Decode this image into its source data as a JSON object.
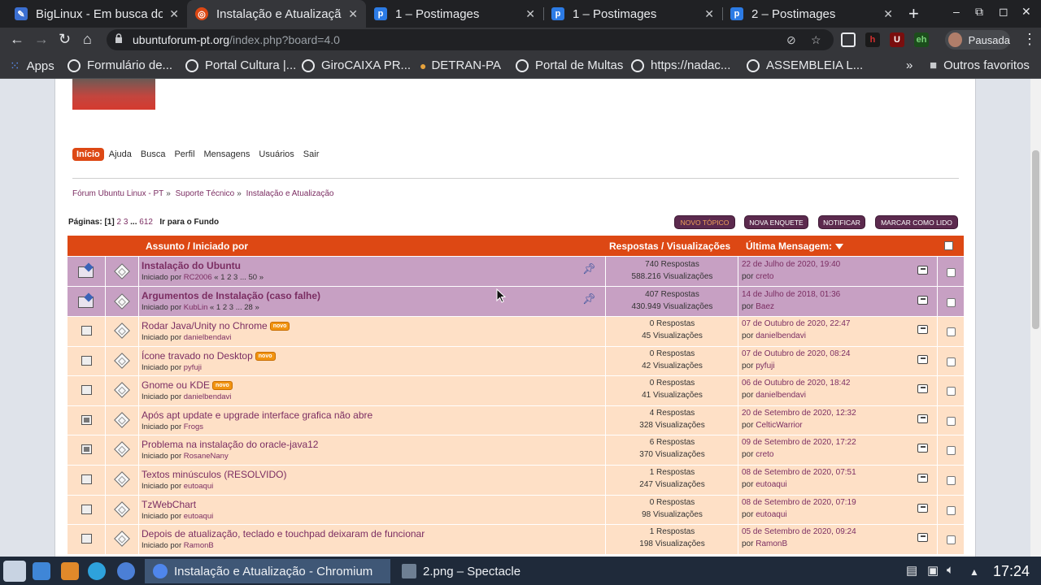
{
  "browser": {
    "tabs": [
      {
        "title": "BigLinux - Em busca do s",
        "fav_color": "#3b6fd1",
        "fav_glyph": "✎"
      },
      {
        "title": "Instalação e Atualização",
        "fav_color": "#dd4814",
        "fav_glyph": "◎",
        "active": true
      },
      {
        "title": "1 – Postimages",
        "fav_color": "#2c7be5",
        "fav_glyph": "p"
      },
      {
        "title": "1 – Postimages",
        "fav_color": "#2c7be5",
        "fav_glyph": "p"
      },
      {
        "title": "2 – Postimages",
        "fav_color": "#2c7be5",
        "fav_glyph": "p"
      }
    ],
    "url_host": "ubuntuforum-pt.org",
    "url_rest": "/index.php?board=4.0",
    "profile_label": "Pausada",
    "bookmarks": [
      "Apps",
      "Formulário de...",
      "Portal Cultura |...",
      "GiroCAIXA PR...",
      "DETRAN-PA",
      "Portal de Multas",
      "https://nadac...",
      "ASSEMBLEIA L...",
      "Outros favoritos"
    ],
    "bookmarks_overflow": "»"
  },
  "forum": {
    "menu": [
      "Início",
      "Ajuda",
      "Busca",
      "Perfil",
      "Mensagens",
      "Usuários",
      "Sair"
    ],
    "breadcrumb": [
      "Fórum Ubuntu Linux - PT",
      "Suporte Técnico",
      "Instalação e Atualização"
    ],
    "pages_label": "Páginas:",
    "pages_current": "1",
    "pages_links": [
      "2",
      "3",
      "...",
      "612"
    ],
    "goto_bottom": "Ir para o Fundo",
    "buttons": [
      "novo tópico",
      "nova enquete",
      "notificar",
      "marcar como lido"
    ],
    "header": {
      "subject": "Assunto / Iniciado por",
      "stats": "Respostas / Visualizações",
      "last": "Última Mensagem:"
    },
    "by_prefix": "Iniciado por",
    "last_prefix": "por",
    "new_badge": "novo",
    "topics": [
      {
        "subject": "Instalação do Ubuntu",
        "author": "RC2006",
        "pages": "« 1 2 3 ... 50 »",
        "replies": "740 Respostas",
        "views": "588.216 Visualizações",
        "last_date": "22 de Julho de 2020, 19:40",
        "last_by": "creto",
        "sticky": true
      },
      {
        "subject": "Argumentos de Instalação (caso falhe)",
        "author": "KubLin",
        "pages": "« 1 2 3 ... 28 »",
        "replies": "407 Respostas",
        "views": "430.949 Visualizações",
        "last_date": "14 de Julho de 2018, 01:36",
        "last_by": "Baez",
        "sticky": true
      },
      {
        "subject": "Rodar Java/Unity no Chrome",
        "author": "danielbendavi",
        "new": true,
        "replies": "0 Respostas",
        "views": "45 Visualizações",
        "last_date": "07 de Outubro de 2020, 22:47",
        "last_by": "danielbendavi"
      },
      {
        "subject": "Ícone travado no Desktop",
        "author": "pyfuji",
        "new": true,
        "replies": "0 Respostas",
        "views": "42 Visualizações",
        "last_date": "07 de Outubro de 2020, 08:24",
        "last_by": "pyfuji"
      },
      {
        "subject": "Gnome ou KDE",
        "author": "danielbendavi",
        "new": true,
        "replies": "0 Respostas",
        "views": "41 Visualizações",
        "last_date": "06 de Outubro de 2020, 18:42",
        "last_by": "danielbendavi"
      },
      {
        "subject": "Após apt update e upgrade interface grafica não abre",
        "author": "Frogs",
        "hot": true,
        "replies": "4 Respostas",
        "views": "328 Visualizações",
        "last_date": "20 de Setembro de 2020, 12:32",
        "last_by": "CelticWarrior"
      },
      {
        "subject": "Problema na instalação do oracle-java12",
        "author": "RosaneNany",
        "hot": true,
        "replies": "6 Respostas",
        "views": "370 Visualizações",
        "last_date": "09 de Setembro de 2020, 17:22",
        "last_by": "creto"
      },
      {
        "subject": "Textos minúsculos (RESOLVIDO)",
        "author": "eutoaqui",
        "replies": "1 Respostas",
        "views": "247 Visualizações",
        "last_date": "08 de Setembro de 2020, 07:51",
        "last_by": "eutoaqui"
      },
      {
        "subject": "TzWebChart",
        "author": "eutoaqui",
        "replies": "0 Respostas",
        "views": "98 Visualizações",
        "last_date": "08 de Setembro de 2020, 07:19",
        "last_by": "eutoaqui"
      },
      {
        "subject": "Depois de atualização, teclado e touchpad deixaram de funcionar",
        "author": "RamonB",
        "replies": "1 Respostas",
        "views": "198 Visualizações",
        "last_date": "05 de Setembro de 2020, 09:24",
        "last_by": "RamonB"
      }
    ]
  },
  "taskbar": {
    "tasks": [
      {
        "label": "Instalação e Atualização - Chromium",
        "icon_color": "#4f86ec",
        "active": true
      },
      {
        "label": "2.png – Spectacle",
        "icon_color": "#6e7f93"
      }
    ],
    "clock": "17:24"
  },
  "colors": {
    "accent": "#dd4814",
    "sticky_row": "#c7a0c3",
    "normal_row": "#fee0c6",
    "link": "#7b2d62"
  }
}
